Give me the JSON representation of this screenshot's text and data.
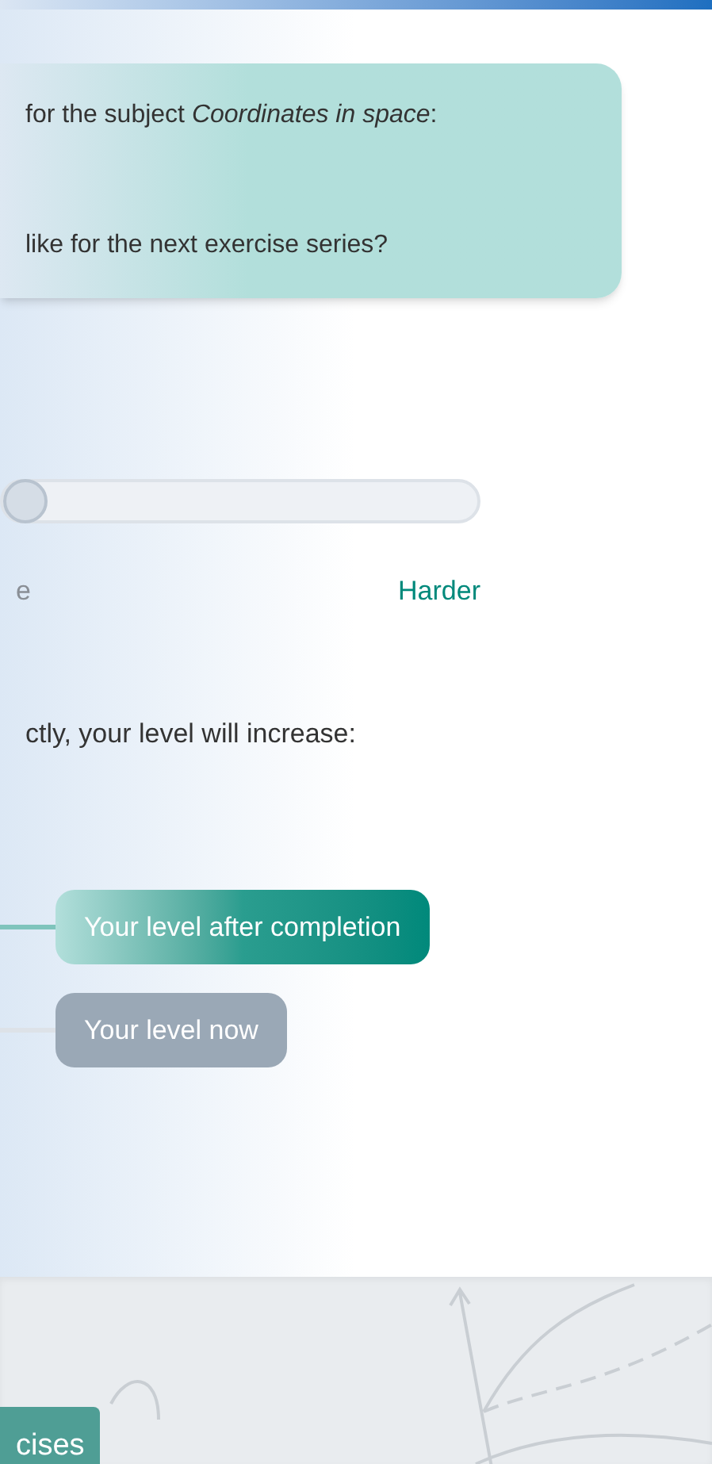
{
  "intro_card": {
    "lines": [
      "for the subject *Coordinates in space*:",
      "like for the next exercise series?"
    ]
  },
  "difficulty_slider": {
    "level": 0,
    "min_label": "e",
    "max_label": "Harder"
  },
  "level_note": "ctly, your level will increase:",
  "level_markers": [
    {
      "label": "Your level after completion",
      "selected": true
    },
    {
      "label": "Your level now",
      "selected": false
    }
  ],
  "footer": {
    "button": "cises"
  }
}
